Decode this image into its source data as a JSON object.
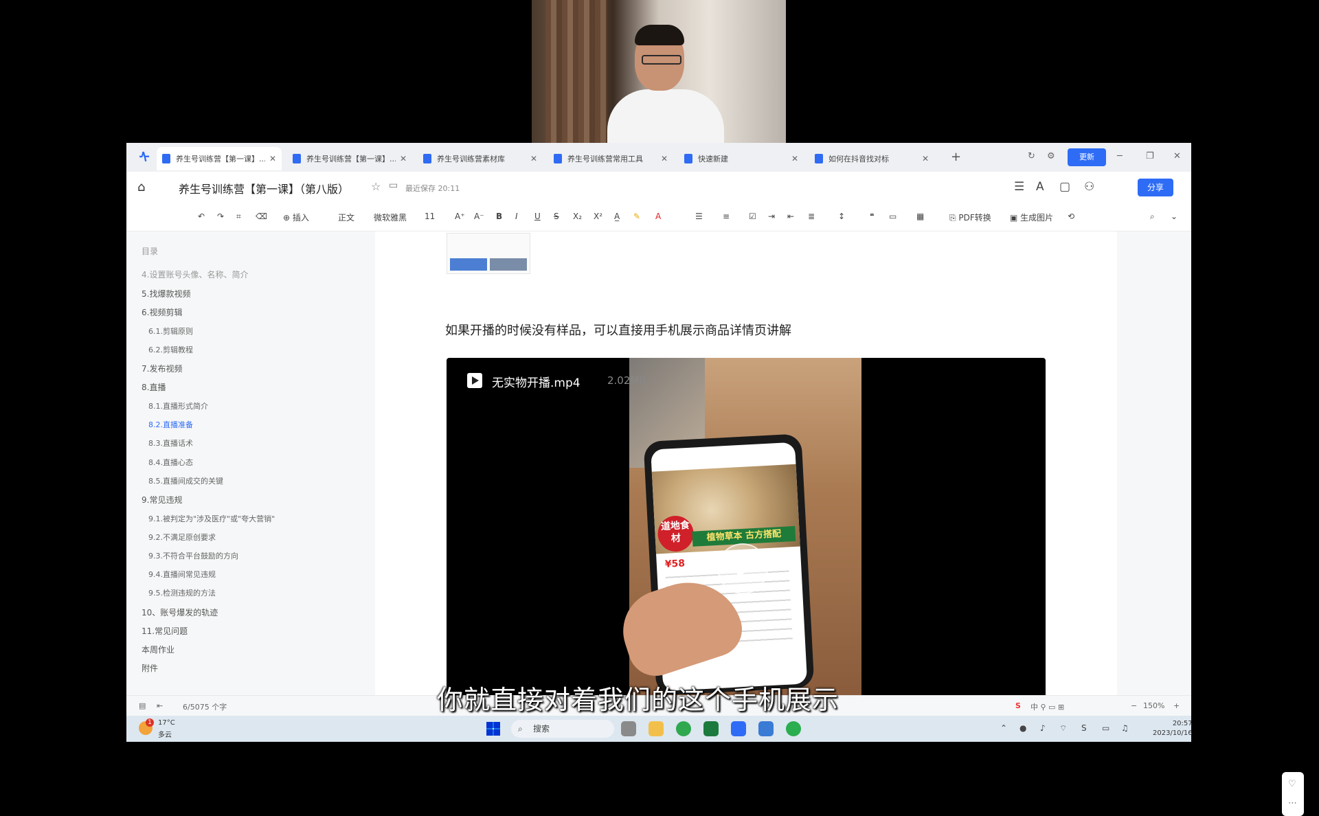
{
  "tabs": [
    {
      "label": "养生号训练营【第一课】..."
    },
    {
      "label": "养生号训练营【第一课】..."
    },
    {
      "label": "养生号训练营素材库"
    },
    {
      "label": "养生号训练营常用工具"
    },
    {
      "label": "快速新建"
    },
    {
      "label": "如何在抖音找对标"
    }
  ],
  "header": {
    "update_label": "更新",
    "doc_title": "养生号训练营【第一课】（第八版）",
    "save_status": "最近保存 20:11",
    "share_label": "分享"
  },
  "toolbar": {
    "insert": "插入",
    "style": "正文",
    "font": "微软雅黑",
    "size": "11",
    "bold": "B",
    "italic": "I",
    "underline": "U",
    "strike": "S",
    "pdf": "PDF转换",
    "genimg": "生成图片"
  },
  "outline": {
    "title": "目录",
    "items": [
      {
        "label": "4.设置账号头像、名称、简介",
        "level": 1
      },
      {
        "label": "5.找爆款视频",
        "level": 1
      },
      {
        "label": "6.视频剪辑",
        "level": 1
      },
      {
        "label": "6.1.剪辑原则",
        "level": 2
      },
      {
        "label": "6.2.剪辑教程",
        "level": 2
      },
      {
        "label": "7.发布视频",
        "level": 1
      },
      {
        "label": "8.直播",
        "level": 1
      },
      {
        "label": "8.1.直播形式简介",
        "level": 2
      },
      {
        "label": "8.2.直播准备",
        "level": 2
      },
      {
        "label": "8.3.直播话术",
        "level": 2
      },
      {
        "label": "8.4.直播心态",
        "level": 2
      },
      {
        "label": "8.5.直播间成交的关键",
        "level": 2
      },
      {
        "label": "9.常见违规",
        "level": 1
      },
      {
        "label": "9.1.被判定为\"涉及医疗\"或\"夸大营销\"",
        "level": 2
      },
      {
        "label": "9.2.不满足原创要求",
        "level": 2
      },
      {
        "label": "9.3.不符合平台鼓励的方向",
        "level": 2
      },
      {
        "label": "9.4.直播间常见违规",
        "level": 2
      },
      {
        "label": "9.5.检测违规的方法",
        "level": 2
      },
      {
        "label": "10、账号爆发的轨迹",
        "level": 1
      },
      {
        "label": "11.常见问题",
        "level": 1
      },
      {
        "label": "本周作业",
        "level": 1
      },
      {
        "label": "附件",
        "level": 1
      }
    ]
  },
  "document": {
    "paragraph": "如果开播的时候没有样品，可以直接用手机展示商品详情页讲解",
    "video_name": "无实物开播.mp4",
    "video_size": "2.02MB",
    "phone_seal": "道地食材",
    "phone_banner": "植物草本 古方搭配",
    "phone_price": "¥58"
  },
  "caption": "你就直接对着我们的这个手机展示",
  "statusbar": {
    "page_info": "6/5075 个字",
    "zoom": "150%"
  },
  "taskbar": {
    "weather_badge": "1",
    "temp": "17°C",
    "weather": "多云",
    "search": "搜索",
    "time": "20:57",
    "date": "2023/10/16"
  },
  "colors": {
    "accent": "#2e6cf6",
    "outline_active": "#2e6cf6"
  }
}
